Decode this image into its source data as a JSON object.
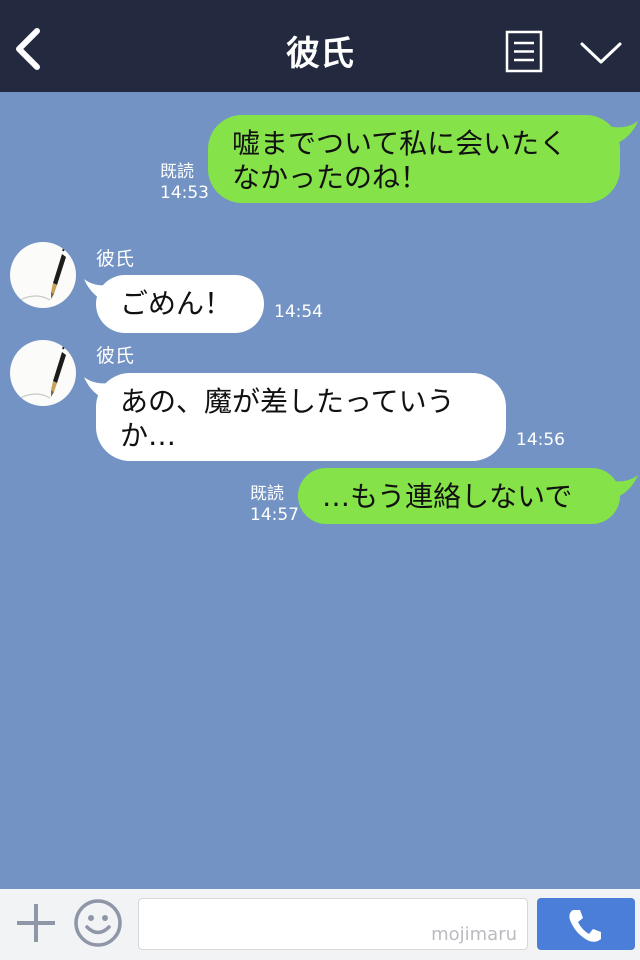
{
  "header": {
    "title": "彼氏",
    "back_icon": "chevron-left-icon",
    "notes_icon": "note-list-icon",
    "menu_icon": "chevron-down-icon"
  },
  "messages": [
    {
      "direction": "outgoing",
      "text_lines": [
        "嘘までついて私に会いたく",
        "なかったのね！"
      ],
      "read_label": "既読",
      "time": "14:53"
    },
    {
      "direction": "incoming",
      "sender": "彼氏",
      "text_lines": [
        "ごめん！"
      ],
      "time": "14:54"
    },
    {
      "direction": "incoming",
      "sender": "彼氏",
      "text_lines": [
        "あの、魔が差したっていう",
        "か…"
      ],
      "time": "14:56"
    },
    {
      "direction": "outgoing",
      "text_lines": [
        "…もう連絡しないで"
      ],
      "read_label": "既読",
      "time": "14:57"
    }
  ],
  "footer": {
    "plus_icon": "plus-icon",
    "emoji_icon": "smiley-icon",
    "input_value": "",
    "watermark": "mojimaru",
    "call_icon": "phone-icon"
  },
  "colors": {
    "background": "#7293c4",
    "header": "#232a40",
    "outgoing_bubble": "#85e249",
    "incoming_bubble": "#ffffff",
    "call_button": "#4a7ed8"
  }
}
